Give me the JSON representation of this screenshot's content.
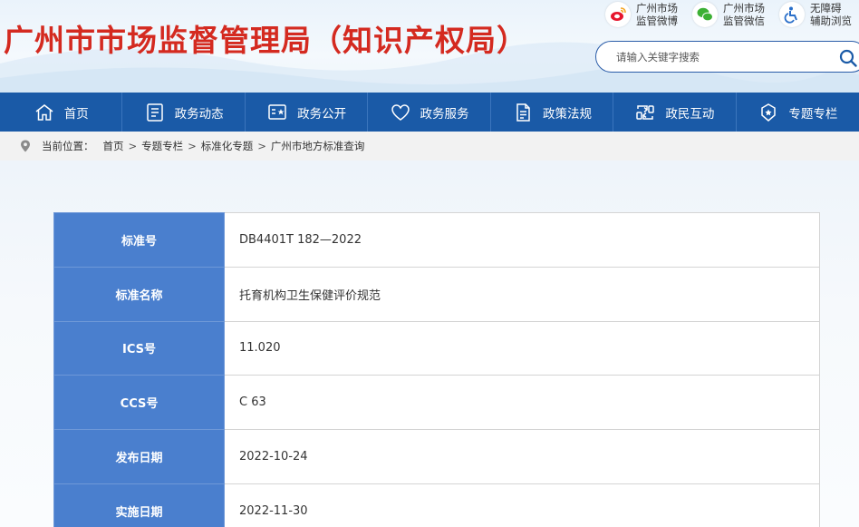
{
  "header": {
    "site_title": "广州市市场监督管理局（知识产权局）",
    "quick_links": [
      {
        "line1": "广州市场",
        "line2": "监管微博",
        "icon": "weibo-icon"
      },
      {
        "line1": "广州市场",
        "line2": "监管微信",
        "icon": "wechat-icon"
      },
      {
        "line1": "无障碍",
        "line2": "辅助浏览",
        "icon": "accessibility-icon"
      }
    ],
    "search": {
      "placeholder": "请输入关键字搜索",
      "icon": "search-icon"
    }
  },
  "nav": {
    "items": [
      {
        "label": "首页",
        "icon": "home-icon"
      },
      {
        "label": "政务动态",
        "icon": "news-icon"
      },
      {
        "label": "政务公开",
        "icon": "public-info-icon"
      },
      {
        "label": "政务服务",
        "icon": "heart-service-icon"
      },
      {
        "label": "政策法规",
        "icon": "document-icon"
      },
      {
        "label": "政民互动",
        "icon": "interaction-icon"
      },
      {
        "label": "专题专栏",
        "icon": "badge-icon"
      }
    ]
  },
  "breadcrumb": {
    "prefix": "当前位置：",
    "items": [
      "首页",
      "专题专栏",
      "标准化专题",
      "广州市地方标准查询"
    ],
    "separator": ">"
  },
  "standard": {
    "rows": [
      {
        "label": "标准号",
        "value": "DB4401T 182—2022"
      },
      {
        "label": "标准名称",
        "value": "托育机构卫生保健评价规范"
      },
      {
        "label": "ICS号",
        "value": "11.020"
      },
      {
        "label": "CCS号",
        "value": "C 63"
      },
      {
        "label": "发布日期",
        "value": "2022-10-24"
      },
      {
        "label": "实施日期",
        "value": "2022-11-30"
      }
    ]
  },
  "colors": {
    "title_red": "#d42a20",
    "nav_blue": "#1a5aa7",
    "label_blue": "#4a7fce"
  }
}
